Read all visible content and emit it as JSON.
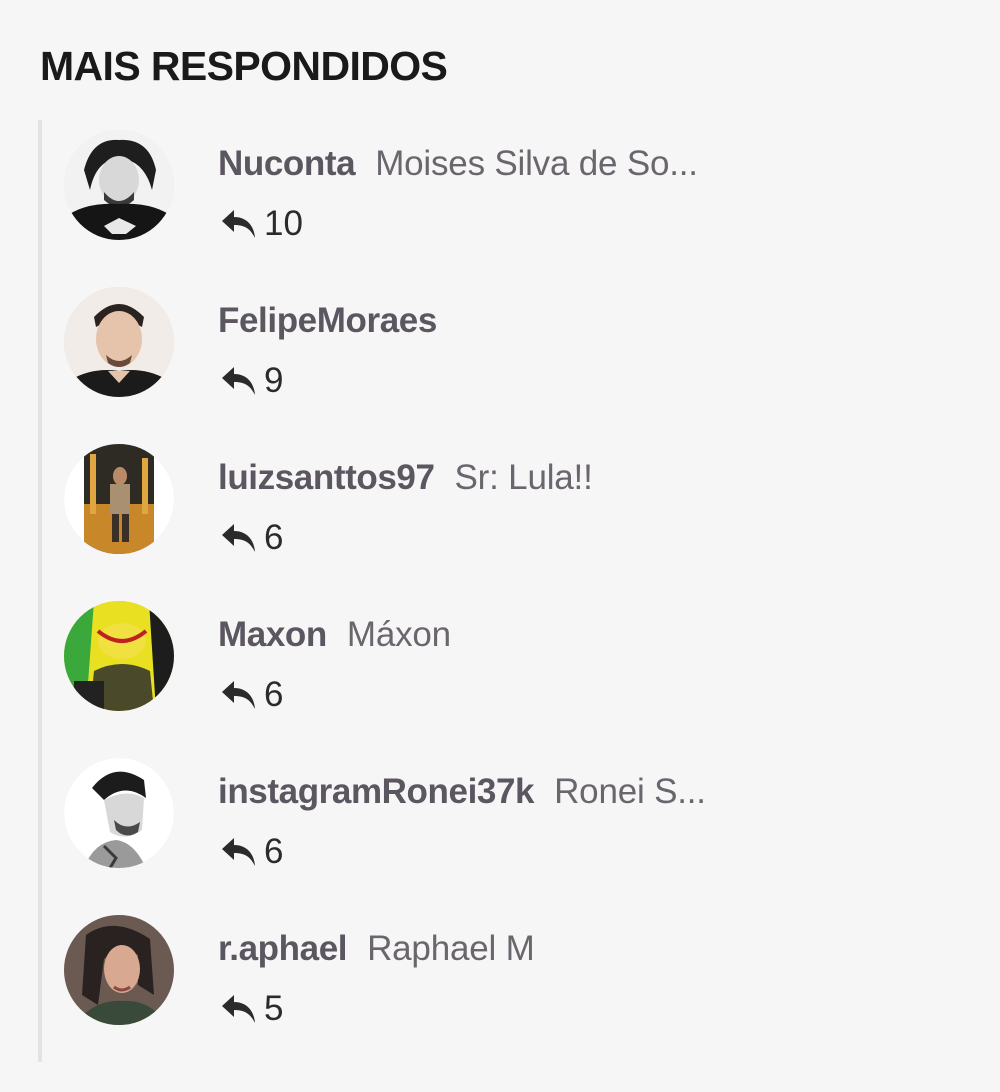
{
  "widget": {
    "title": "MAIS RESPONDIDOS"
  },
  "users": [
    {
      "username": "Nuconta",
      "fullname": "Moises Silva de So...",
      "replies": "10",
      "avatar_icon": "user-avatar-photo"
    },
    {
      "username": "FelipeMoraes",
      "fullname": "",
      "replies": "9",
      "avatar_icon": "user-avatar-photo"
    },
    {
      "username": "luizsanttos97",
      "fullname": "Sr: Lula!!",
      "replies": "6",
      "avatar_icon": "user-avatar-photo"
    },
    {
      "username": "Maxon",
      "fullname": "Máxon",
      "replies": "6",
      "avatar_icon": "user-avatar-photo"
    },
    {
      "username": "instagramRonei37k",
      "fullname": "Ronei S...",
      "replies": "6",
      "avatar_icon": "user-avatar-photo"
    },
    {
      "username": "r.aphael",
      "fullname": "Raphael M",
      "replies": "5",
      "avatar_icon": "user-avatar-photo"
    }
  ],
  "icons": {
    "reply": "reply-arrow-icon"
  },
  "colors": {
    "background": "#f6f6f6",
    "title": "#1a1a1a",
    "username": "#5c5660",
    "fullname": "#6b656e",
    "divider": "#e3e3e3"
  }
}
